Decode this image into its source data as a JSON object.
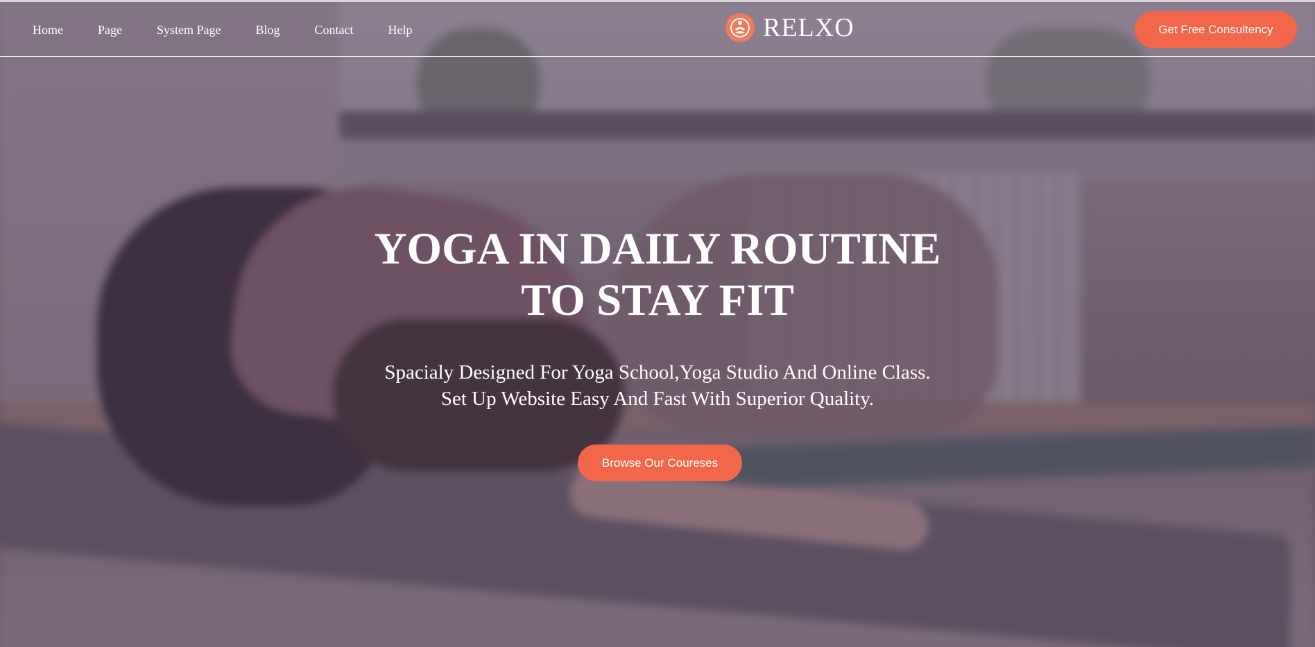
{
  "nav": {
    "items": [
      {
        "label": "Home"
      },
      {
        "label": "Page"
      },
      {
        "label": "System Page"
      },
      {
        "label": "Blog"
      },
      {
        "label": "Contact"
      },
      {
        "label": "Help"
      }
    ]
  },
  "brand": {
    "name": "RELXO",
    "icon": "meditation-icon",
    "accent_color": "#f26749"
  },
  "header": {
    "cta_label": "Get Free Consultency"
  },
  "hero": {
    "title_line1": "YOGA IN DAILY ROUTINE",
    "title_line2": "TO STAY FIT",
    "subtitle_line1": "Spacialy Designed For Yoga School,Yoga Studio And Online Class.",
    "subtitle_line2": "Set Up Website Easy And Fast With Superior Quality.",
    "cta_label": "Browse Our Coureses"
  }
}
